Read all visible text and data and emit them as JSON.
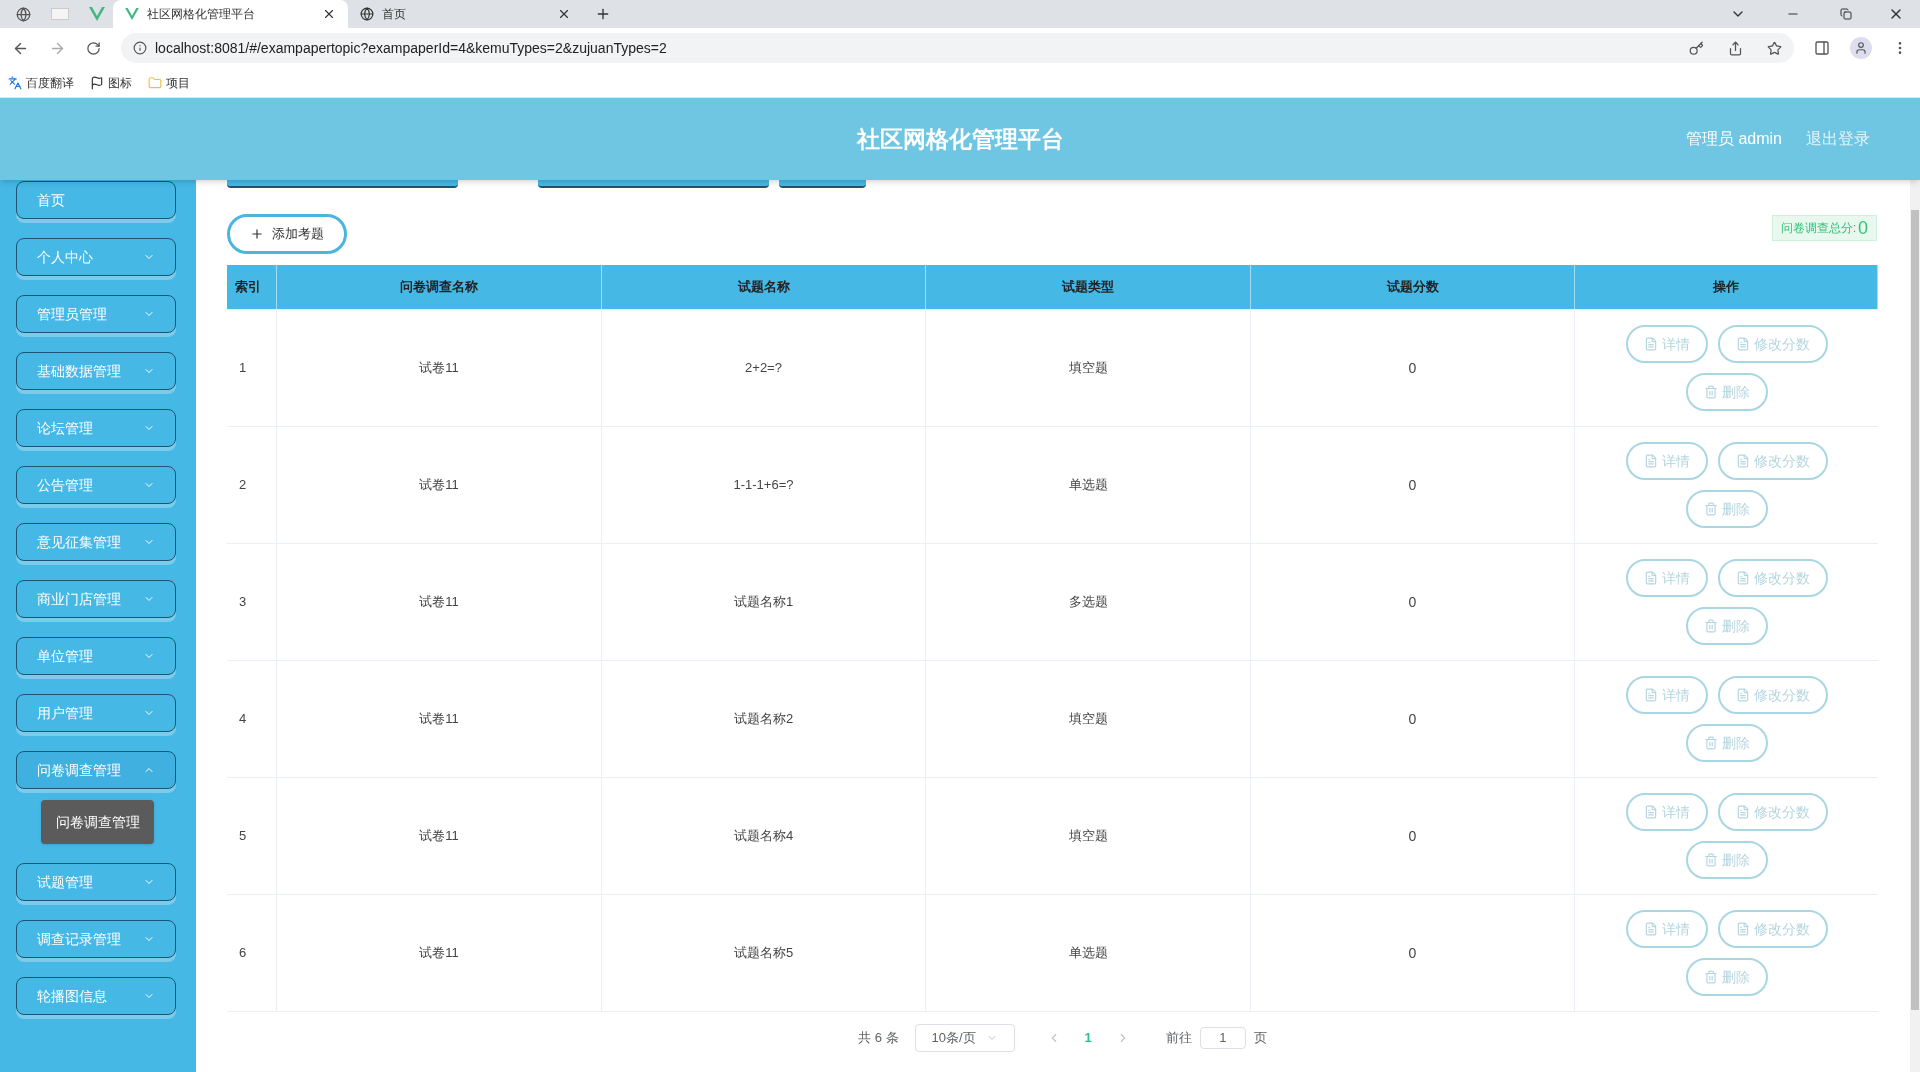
{
  "browser": {
    "tabs": [
      {
        "title": "社区网格化管理平台",
        "selected": true
      },
      {
        "title": "首页",
        "selected": false
      }
    ],
    "url": "localhost:8081/#/exampapertopic?exampaperId=4&kemuTypes=2&zujuanTypes=2",
    "bookmarks": [
      "百度翻译",
      "图标",
      "项目"
    ]
  },
  "header": {
    "title": "社区网格化管理平台",
    "user": "管理员 admin",
    "logout": "退出登录"
  },
  "sidebar": [
    {
      "label": "首页",
      "kind": "link"
    },
    {
      "label": "个人中心",
      "kind": "menu",
      "expanded": false
    },
    {
      "label": "管理员管理",
      "kind": "menu",
      "expanded": false
    },
    {
      "label": "基础数据管理",
      "kind": "menu",
      "expanded": false
    },
    {
      "label": "论坛管理",
      "kind": "menu",
      "expanded": false
    },
    {
      "label": "公告管理",
      "kind": "menu",
      "expanded": false
    },
    {
      "label": "意见征集管理",
      "kind": "menu",
      "expanded": false
    },
    {
      "label": "商业门店管理",
      "kind": "menu",
      "expanded": false
    },
    {
      "label": "单位管理",
      "kind": "menu",
      "expanded": false
    },
    {
      "label": "用户管理",
      "kind": "menu",
      "expanded": false
    },
    {
      "label": "问卷调查管理",
      "kind": "menu",
      "expanded": true,
      "children": [
        "问卷调查管理"
      ]
    },
    {
      "label": "试题管理",
      "kind": "menu",
      "expanded": false
    },
    {
      "label": "调查记录管理",
      "kind": "menu",
      "expanded": false
    },
    {
      "label": "轮播图信息",
      "kind": "menu",
      "expanded": false
    }
  ],
  "toolbar": {
    "add_button": "添加考题",
    "total_label": "问卷调查总分:",
    "total_value": "0"
  },
  "table": {
    "columns": [
      "索引",
      "问卷调查名称",
      "试题名称",
      "试题类型",
      "试题分数",
      "操作"
    ],
    "rows": [
      {
        "cells": [
          "1",
          "试卷11",
          "2+2=?",
          "填空题",
          "0"
        ],
        "actions": [
          "详情",
          "修改分数",
          "删除"
        ]
      },
      {
        "cells": [
          "2",
          "试卷11",
          "1-1-1+6=?",
          "单选题",
          "0"
        ],
        "actions": [
          "详情",
          "修改分数",
          "删除"
        ]
      },
      {
        "cells": [
          "3",
          "试卷11",
          "试题名称1",
          "多选题",
          "0"
        ],
        "actions": [
          "详情",
          "修改分数",
          "删除"
        ]
      },
      {
        "cells": [
          "4",
          "试卷11",
          "试题名称2",
          "填空题",
          "0"
        ],
        "actions": [
          "详情",
          "修改分数",
          "删除"
        ]
      },
      {
        "cells": [
          "5",
          "试卷11",
          "试题名称4",
          "填空题",
          "0"
        ],
        "actions": [
          "详情",
          "修改分数",
          "删除"
        ]
      },
      {
        "cells": [
          "6",
          "试卷11",
          "试题名称5",
          "单选题",
          "0"
        ],
        "actions": [
          "详情",
          "修改分数",
          "删除"
        ]
      }
    ]
  },
  "pagination": {
    "total": "共 6 条",
    "page_size": "10条/页",
    "pages": [
      {
        "label": "1",
        "selected": true
      }
    ],
    "goto_label": "前往",
    "goto_value": "1",
    "goto_suffix": "页"
  }
}
